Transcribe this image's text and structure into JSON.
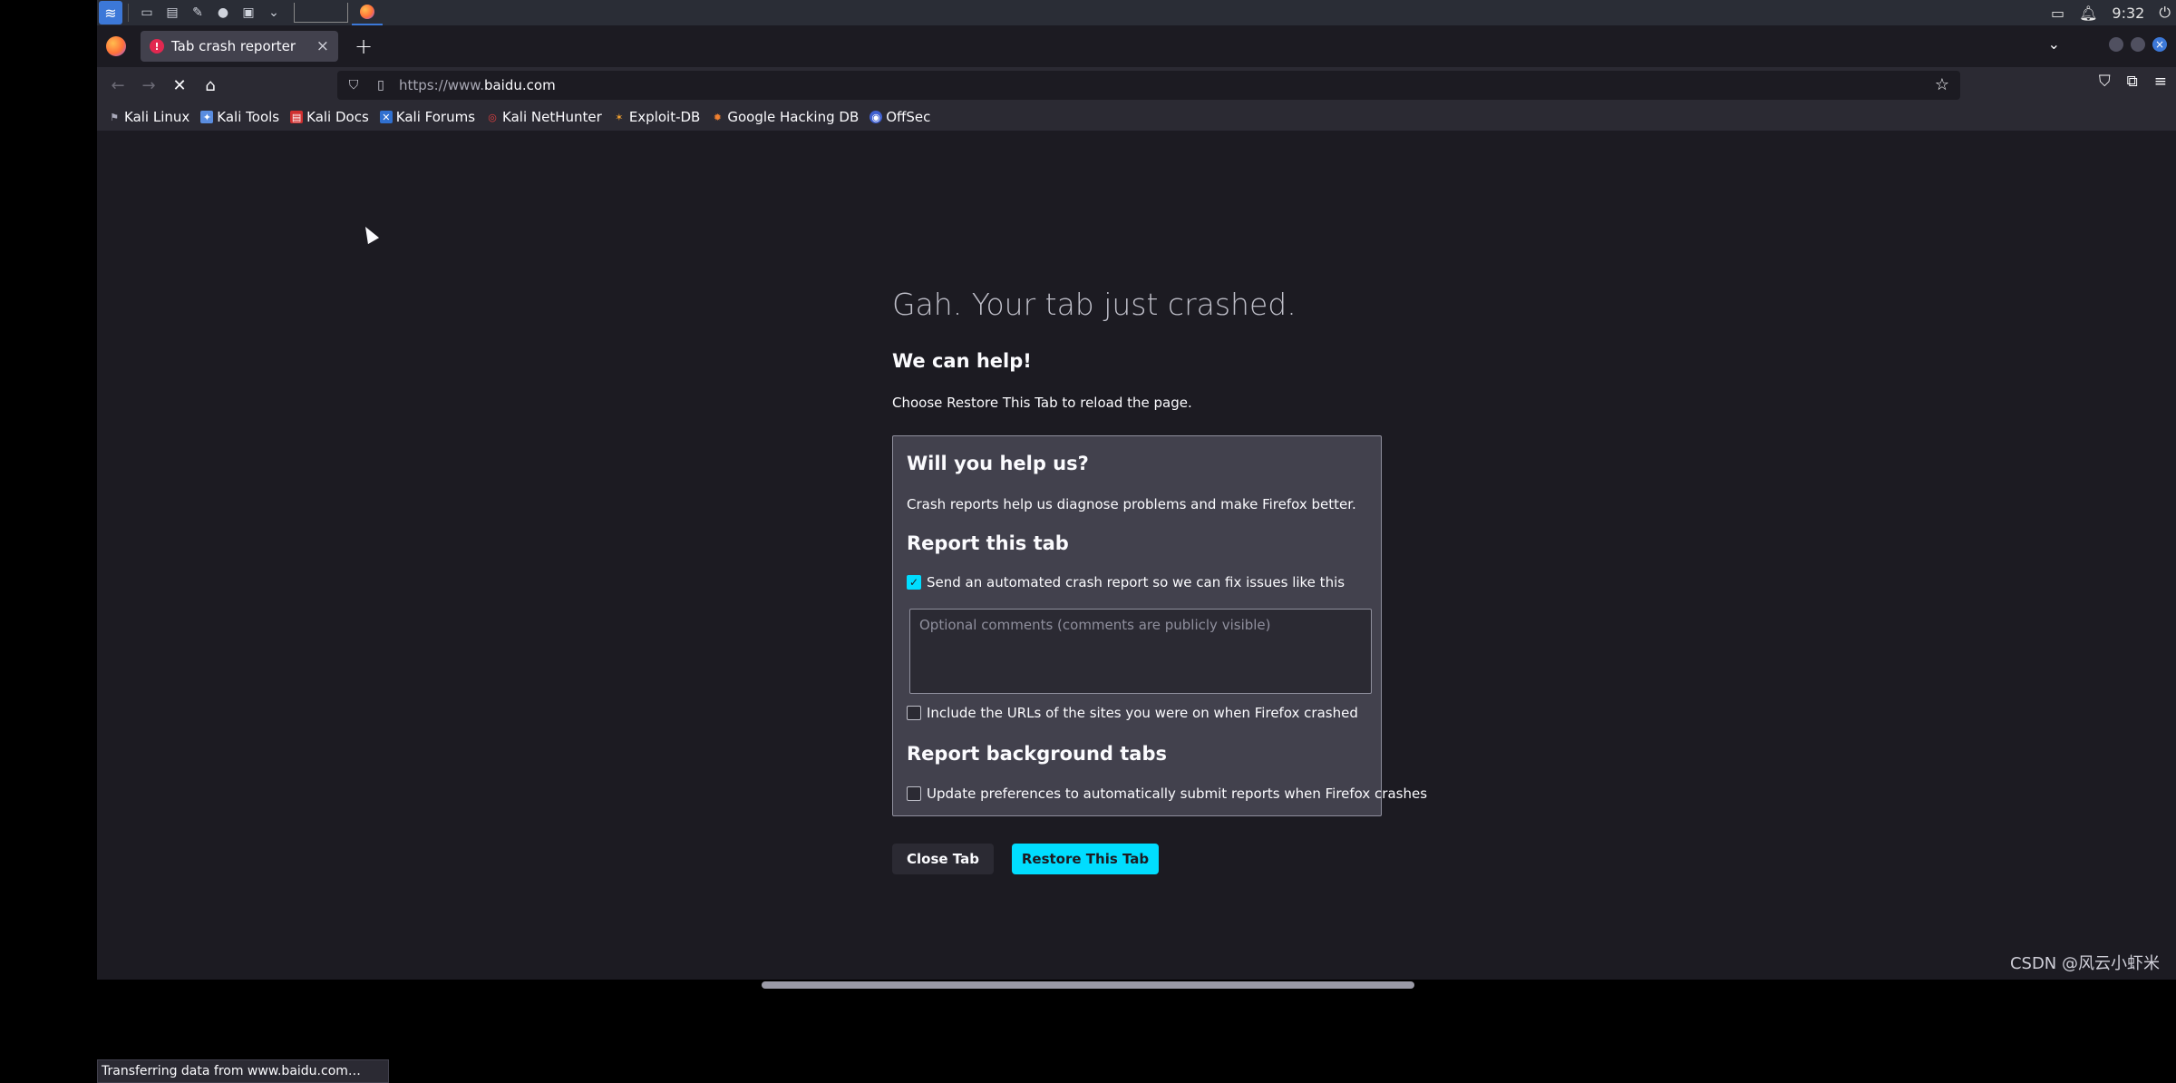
{
  "taskbar": {
    "clock": "9:32"
  },
  "tab": {
    "title": "Tab crash reporter",
    "close_glyph": "×",
    "new_tab_glyph": "+"
  },
  "nav": {
    "url_proto": "https://www.",
    "url_domain": "baidu.com"
  },
  "bookmarks": [
    {
      "label": "Kali Linux"
    },
    {
      "label": "Kali Tools"
    },
    {
      "label": "Kali Docs"
    },
    {
      "label": "Kali Forums"
    },
    {
      "label": "Kali NetHunter"
    },
    {
      "label": "Exploit-DB"
    },
    {
      "label": "Google Hacking DB"
    },
    {
      "label": "OffSec"
    }
  ],
  "crash": {
    "title": "Gah. Your tab just crashed.",
    "help_title": "We can help!",
    "help_text": "Choose Restore This Tab to reload the page.",
    "box_title": "Will you help us?",
    "box_text": "Crash reports help us diagnose problems and make Firefox better.",
    "report_title": "Report this tab",
    "send_report_label": "Send an automated crash report so we can fix issues like this",
    "send_report_checked": true,
    "comments_placeholder": "Optional comments (comments are publicly visible)",
    "include_urls_label": "Include the URLs of the sites you were on when Firefox crashed",
    "bg_title": "Report background tabs",
    "update_prefs_label": "Update preferences to automatically submit reports when Firefox crashes",
    "close_button": "Close Tab",
    "restore_button": "Restore This Tab"
  },
  "status": {
    "text": "Transferring data from www.baidu.com…"
  },
  "watermark": "CSDN @风云小虾米",
  "colors": {
    "accent": "#00ddff",
    "background": "#1c1b22",
    "panel": "#42414d"
  }
}
